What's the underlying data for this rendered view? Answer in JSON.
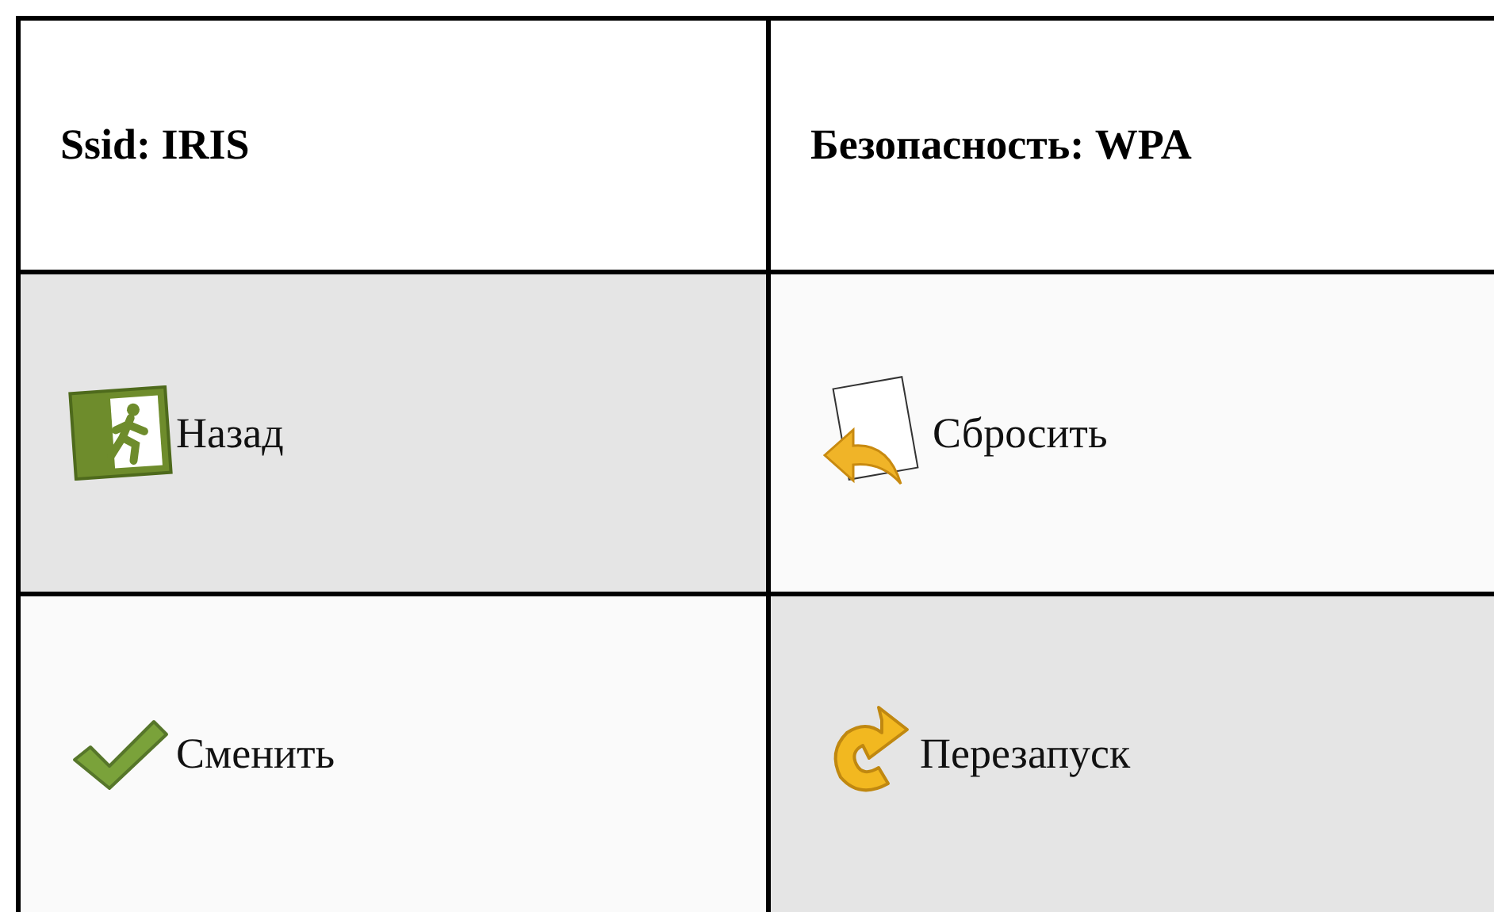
{
  "header": [
    {
      "label": "Ssid: IRIS"
    },
    {
      "label": "Безопасность: WPA"
    }
  ],
  "buttons": [
    {
      "label": "Назад",
      "kind": "exit",
      "shaded": true
    },
    {
      "label": "Сбросить",
      "kind": "reset",
      "shaded": false
    },
    {
      "label": "Сменить",
      "kind": "apply",
      "shaded": false
    },
    {
      "label": "Перезапуск",
      "kind": "restart",
      "shaded": true
    }
  ]
}
